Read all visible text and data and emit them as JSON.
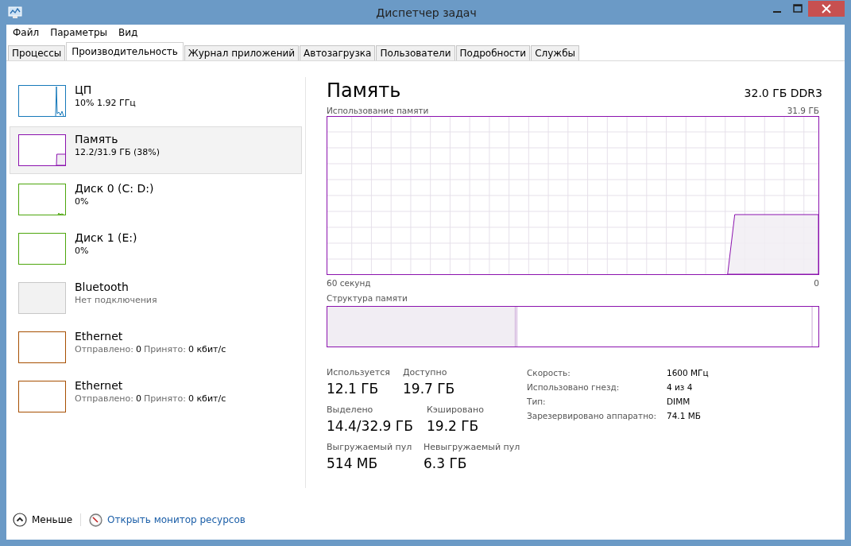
{
  "window": {
    "title": "Диспетчер задач"
  },
  "menu": [
    "Файл",
    "Параметры",
    "Вид"
  ],
  "tabs": [
    {
      "label": "Процессы",
      "selected": false
    },
    {
      "label": "Производительность",
      "selected": true
    },
    {
      "label": "Журнал приложений",
      "selected": false
    },
    {
      "label": "Автозагрузка",
      "selected": false
    },
    {
      "label": "Пользователи",
      "selected": false
    },
    {
      "label": "Подробности",
      "selected": false
    },
    {
      "label": "Службы",
      "selected": false
    }
  ],
  "sidebar": {
    "items": [
      {
        "kind": "cpu",
        "name": "ЦП",
        "detail": "10%  1.92 ГГц",
        "color": "#1779ba",
        "selected": false
      },
      {
        "kind": "memory",
        "name": "Память",
        "detail": "12.2/31.9 ГБ (38%)",
        "color": "#8b12ae",
        "selected": true
      },
      {
        "kind": "disk",
        "name": "Диск 0 (C: D:)",
        "detail": "0%",
        "color": "#4da60c",
        "selected": false
      },
      {
        "kind": "disk",
        "name": "Диск 1 (E:)",
        "detail": "0%",
        "color": "#4da60c",
        "selected": false
      },
      {
        "kind": "bluetooth",
        "name": "Bluetooth",
        "detail": "Нет подключения",
        "color": "#c8c8c8",
        "selected": false
      },
      {
        "kind": "ethernet",
        "name": "Ethernet",
        "sent_label": "Отправлено:",
        "sent": "0",
        "recv_label": "Принято:",
        "recv": "0 кбит/с",
        "color": "#a74f01",
        "selected": false
      },
      {
        "kind": "ethernet",
        "name": "Ethernet",
        "sent_label": "Отправлено:",
        "sent": "0",
        "recv_label": "Принято:",
        "recv": "0 кбит/с",
        "color": "#a74f01",
        "selected": false
      }
    ]
  },
  "detail": {
    "title": "Память",
    "spec": "32.0 ГБ DDR3",
    "usage_label": "Использование памяти",
    "usage_max": "31.9 ГБ",
    "time_label": "60 секунд",
    "time_end": "0",
    "composition_label": "Структура памяти",
    "stats": [
      {
        "label": "Используется",
        "value": "12.1 ГБ"
      },
      {
        "label": "Доступно",
        "value": "19.7 ГБ"
      },
      {
        "label": "Выделено",
        "value": "14.4/32.9 ГБ"
      },
      {
        "label": "Кэшировано",
        "value": "19.2 ГБ"
      },
      {
        "label": "Выгружаемый пул",
        "value": "514 МБ"
      },
      {
        "label": "Невыгружаемый пул",
        "value": "6.3 ГБ"
      }
    ],
    "properties": [
      {
        "label": "Скорость:",
        "value": "1600 МГц"
      },
      {
        "label": "Использовано гнезд:",
        "value": "4 из 4"
      },
      {
        "label": "Тип:",
        "value": "DIMM"
      },
      {
        "label": "Зарезервировано аппаратно:",
        "value": "74.1 МБ"
      }
    ]
  },
  "footer": {
    "less": "Меньше",
    "monitor_link": "Открыть монитор ресурсов"
  }
}
